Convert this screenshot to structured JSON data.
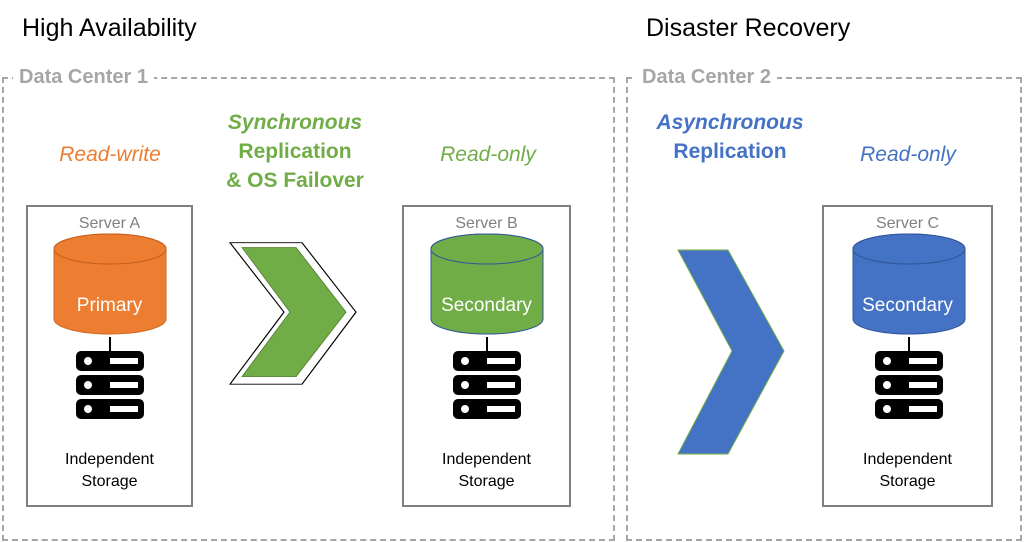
{
  "sections": {
    "ha_title": "High Availability",
    "dr_title": "Disaster Recovery"
  },
  "data_centers": [
    {
      "label": "Data Center 1"
    },
    {
      "label": "Data Center 2"
    }
  ],
  "replication": {
    "sync": {
      "line1": "Synchronous",
      "line2": "Replication",
      "line3": "& OS Failover",
      "color": "#70ad47"
    },
    "async": {
      "line1": "Asynchronous",
      "line2": "Replication",
      "color": "#4472c4"
    }
  },
  "servers": [
    {
      "name": "Server A",
      "role": "Read-write",
      "db_label": "Primary",
      "storage_line1": "Independent",
      "storage_line2": "Storage",
      "color": "#ed7d31"
    },
    {
      "name": "Server B",
      "role": "Read-only",
      "db_label": "Secondary",
      "storage_line1": "Independent",
      "storage_line2": "Storage",
      "color": "#70ad47"
    },
    {
      "name": "Server C",
      "role": "Read-only",
      "db_label": "Secondary",
      "storage_line1": "Independent",
      "storage_line2": "Storage",
      "color": "#4472c4"
    }
  ]
}
